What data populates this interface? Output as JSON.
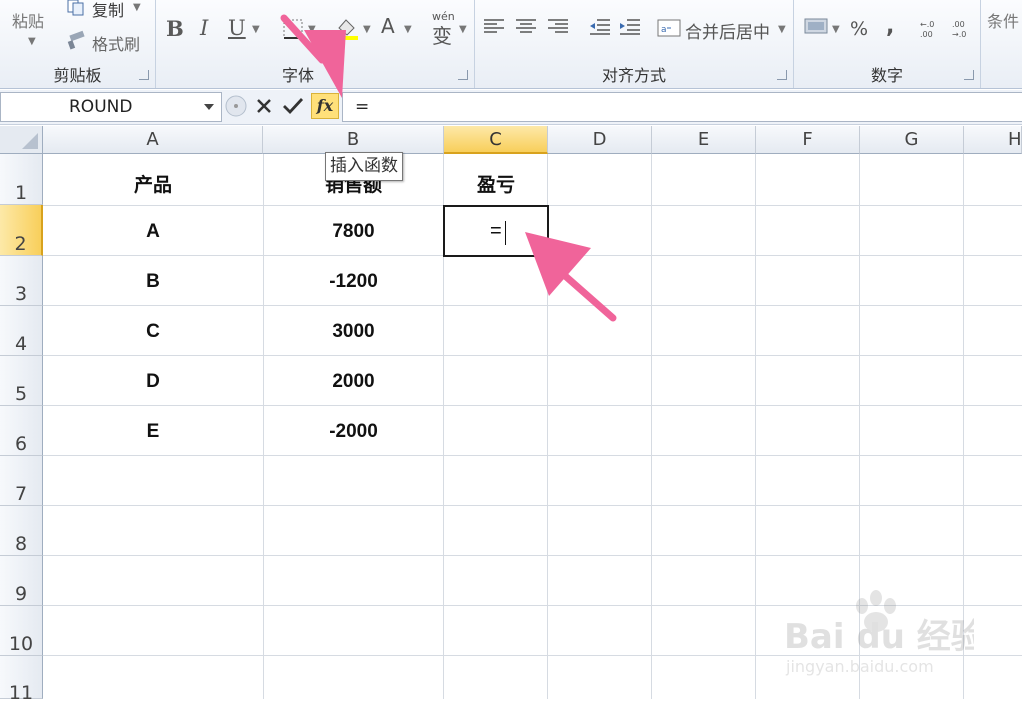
{
  "ribbon": {
    "clipboard": {
      "paste_label": "粘贴",
      "copy_label": "复制",
      "format_painter_label": "格式刷",
      "group_label": "剪贴板"
    },
    "font": {
      "bold": "B",
      "italic": "I",
      "underline": "U",
      "font_color": "A",
      "phonetic": "wén",
      "phonetic_char": "变",
      "group_label": "字体"
    },
    "alignment": {
      "merge_label": "合并后居中",
      "group_label": "对齐方式"
    },
    "number": {
      "percent": "%",
      "comma": ",",
      "group_label": "数字"
    },
    "styles": {
      "conditional_label": "条件"
    }
  },
  "formula_bar": {
    "name_box": "ROUND",
    "formula": "="
  },
  "tooltip": "插入函数",
  "columns": [
    "A",
    "B",
    "C",
    "D",
    "E",
    "F",
    "G",
    "H"
  ],
  "rows": [
    "1",
    "2",
    "3",
    "4",
    "5",
    "6",
    "7",
    "8",
    "9",
    "10",
    "11"
  ],
  "table": {
    "headers": {
      "product": "产品",
      "sales": "销售额",
      "profit": "盈亏"
    },
    "rows": [
      {
        "product": "A",
        "sales": "7800"
      },
      {
        "product": "B",
        "sales": "-1200"
      },
      {
        "product": "C",
        "sales": "3000"
      },
      {
        "product": "D",
        "sales": "2000"
      },
      {
        "product": "E",
        "sales": "-2000"
      }
    ]
  },
  "active_cell": {
    "ref": "C2",
    "value": "="
  },
  "watermark": {
    "line1": "Bai du 经验",
    "line2": "jingyan.baidu.com"
  },
  "colors": {
    "selected_header": "#f8cf5b",
    "arrow": "#f0649a",
    "fx_button": "#ffe07a"
  }
}
